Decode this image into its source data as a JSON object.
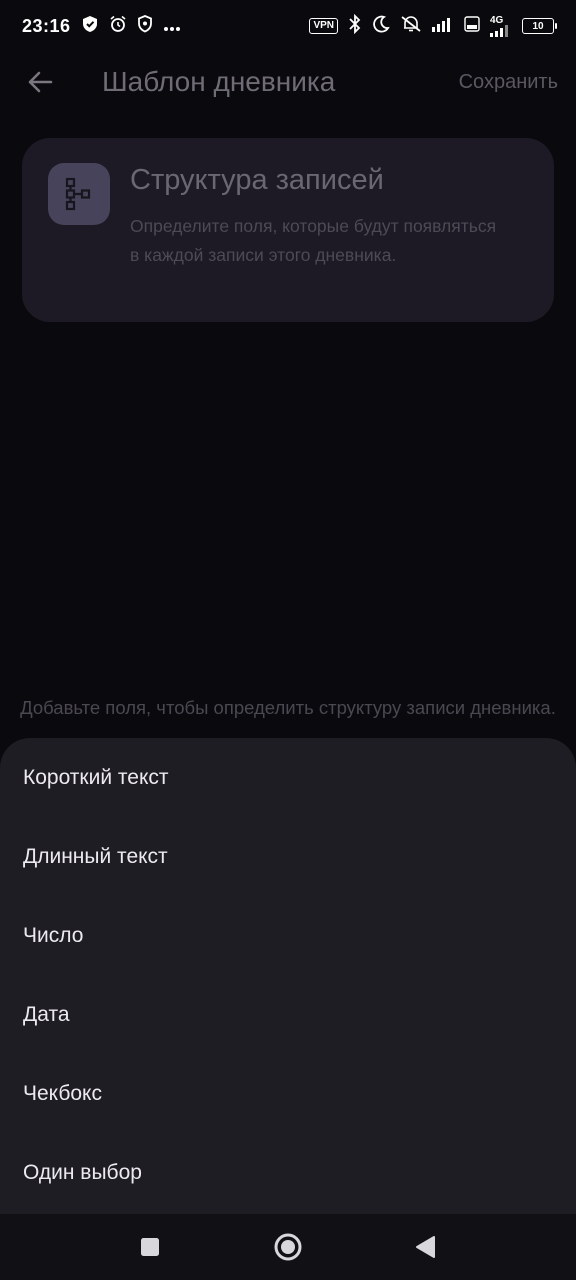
{
  "status_bar": {
    "time": "23:16",
    "vpn_label": "VPN",
    "network_label": "4G",
    "battery": "10",
    "icons": [
      "shield-icon",
      "alarm-icon",
      "privacy-icon",
      "more-dots-icon",
      "bluetooth-icon",
      "moon-icon",
      "silent-icon",
      "signal-icon",
      "volte-icon",
      "signal-4g-icon",
      "battery-icon"
    ]
  },
  "top_bar": {
    "title": "Шаблон дневника",
    "save_label": "Сохранить",
    "back_icon": "back-arrow-icon"
  },
  "info_card": {
    "icon": "structure-icon",
    "title": "Структура записей",
    "description": "Определите поля, которые будут появляться в каждой записи этого дневника."
  },
  "empty_state": {
    "hint": "Добавьте поля, чтобы определить структуру записи дневника."
  },
  "field_type_sheet": {
    "items": [
      {
        "label": "Короткий текст"
      },
      {
        "label": "Длинный текст"
      },
      {
        "label": "Число"
      },
      {
        "label": "Дата"
      },
      {
        "label": "Чекбокс"
      },
      {
        "label": "Один выбор"
      }
    ]
  },
  "nav_bar": {
    "buttons": [
      "recents-square-icon",
      "home-circle-icon",
      "back-triangle-icon"
    ]
  },
  "colors": {
    "background": "#0a090d",
    "card": "#1d1a26",
    "sheet": "#1e1d23",
    "icon_tile": "#47435a"
  }
}
